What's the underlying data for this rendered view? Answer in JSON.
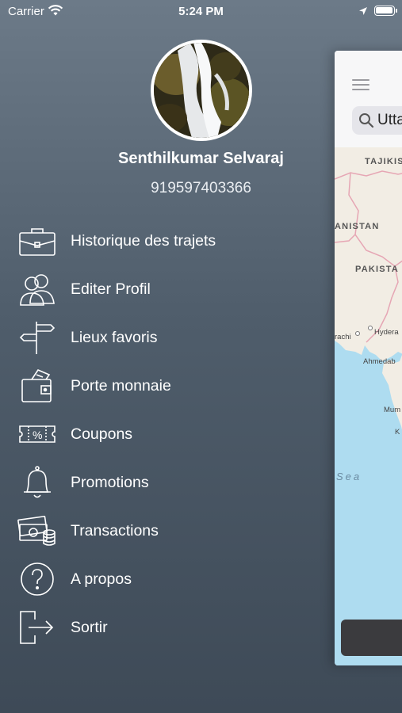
{
  "status_bar": {
    "carrier": "Carrier",
    "time": "5:24 PM"
  },
  "profile": {
    "name": "Senthilkumar Selvaraj",
    "phone": "919597403366"
  },
  "menu": {
    "items": [
      {
        "label": "Historique des trajets",
        "icon": "briefcase-icon"
      },
      {
        "label": "Editer Profil",
        "icon": "users-icon"
      },
      {
        "label": "Lieux favoris",
        "icon": "signpost-icon"
      },
      {
        "label": "Porte monnaie",
        "icon": "wallet-icon"
      },
      {
        "label": "Coupons",
        "icon": "coupon-icon"
      },
      {
        "label": "Promotions",
        "icon": "bell-icon"
      },
      {
        "label": "Transactions",
        "icon": "cash-icon"
      },
      {
        "label": "A propos",
        "icon": "question-icon"
      },
      {
        "label": "Sortir",
        "icon": "logout-icon"
      }
    ]
  },
  "map_panel": {
    "search_text": "Uttar",
    "labels": {
      "tajikistan": "TAJIKIS",
      "afghanistan": "ANISTAN",
      "pakistan": "PAKISTA",
      "karachi": "rachi",
      "hyderabad": "Hydera",
      "ahmedabad": "Ahmedab",
      "mumbai": "Mum",
      "kolhapur": "K",
      "sea": "Sea"
    }
  },
  "colors": {
    "background_top": "#6c7a88",
    "background_bottom": "#3e4a57",
    "map_land": "#f2ede4",
    "map_sea": "#aedcf0",
    "border": "#e6a6b4"
  }
}
